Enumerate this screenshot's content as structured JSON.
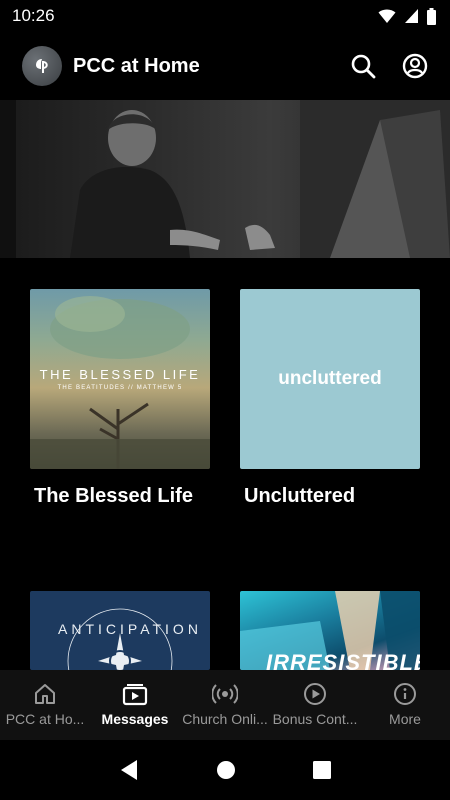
{
  "status_bar": {
    "time": "10:26",
    "icons": [
      "wifi-icon",
      "signal-icon",
      "battery-icon"
    ]
  },
  "app_bar": {
    "title": "PCC at Home",
    "actions": [
      "search-icon",
      "account-icon"
    ]
  },
  "hero": {
    "description_icon": "speaker-photo"
  },
  "series": [
    {
      "title": "The Blessed Life",
      "art_text": "THE BLESSED LIFE",
      "art_subtext": "THE BEATITUDES // MATTHEW 5"
    },
    {
      "title": "Uncluttered",
      "art_text": "uncluttered"
    },
    {
      "title": "",
      "art_text": "ANTICIPATION"
    },
    {
      "title": "",
      "art_text": "IRRESISTIBLE"
    }
  ],
  "bottom_nav": {
    "items": [
      {
        "label": "PCC at Ho...",
        "icon": "home-icon",
        "active": false
      },
      {
        "label": "Messages",
        "icon": "video-library-icon",
        "active": true
      },
      {
        "label": "Church Onli...",
        "icon": "live-broadcast-icon",
        "active": false
      },
      {
        "label": "Bonus Cont...",
        "icon": "play-circle-icon",
        "active": false
      },
      {
        "label": "More",
        "icon": "info-icon",
        "active": false
      }
    ]
  },
  "system_nav": [
    "back-icon",
    "home-circle-icon",
    "recents-icon"
  ],
  "colors": {
    "background": "#000000",
    "nav_background": "#111111",
    "inactive": "#9a9a9a",
    "uncluttered_bg": "#9cc9d2"
  }
}
